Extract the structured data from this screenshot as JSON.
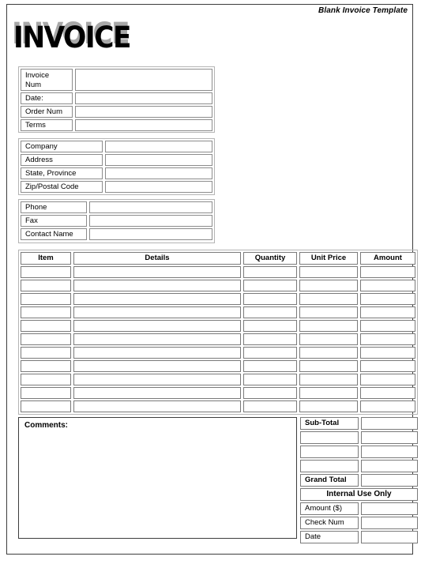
{
  "header": {
    "title": "Blank Invoice Template"
  },
  "wordmark": {
    "text": "INVOICE",
    "shadow_color": "#a8a8a8",
    "text_color": "#000000"
  },
  "invoice_fields": [
    {
      "label": "Invoice\nNum",
      "value": "",
      "two_line": true
    },
    {
      "label": "Date:",
      "value": "",
      "two_line": false
    },
    {
      "label": "Order Num",
      "value": "",
      "two_line": false
    },
    {
      "label": "Terms",
      "value": "",
      "two_line": false
    }
  ],
  "company_fields": [
    {
      "label": "Company",
      "value": ""
    },
    {
      "label": "Address",
      "value": ""
    },
    {
      "label": "State, Province",
      "value": ""
    },
    {
      "label": "Zip/Postal Code",
      "value": ""
    }
  ],
  "contact_fields": [
    {
      "label": "Phone",
      "value": ""
    },
    {
      "label": "Fax",
      "value": ""
    },
    {
      "label": "Contact Name",
      "value": ""
    }
  ],
  "items_table": {
    "columns": [
      "Item",
      "Details",
      "Quantity",
      "Unit Price",
      "Amount"
    ],
    "rows": [
      {
        "item": "",
        "details": "",
        "quantity": "",
        "unit_price": "",
        "amount": ""
      },
      {
        "item": "",
        "details": "",
        "quantity": "",
        "unit_price": "",
        "amount": ""
      },
      {
        "item": "",
        "details": "",
        "quantity": "",
        "unit_price": "",
        "amount": ""
      },
      {
        "item": "",
        "details": "",
        "quantity": "",
        "unit_price": "",
        "amount": ""
      },
      {
        "item": "",
        "details": "",
        "quantity": "",
        "unit_price": "",
        "amount": ""
      },
      {
        "item": "",
        "details": "",
        "quantity": "",
        "unit_price": "",
        "amount": ""
      },
      {
        "item": "",
        "details": "",
        "quantity": "",
        "unit_price": "",
        "amount": ""
      },
      {
        "item": "",
        "details": "",
        "quantity": "",
        "unit_price": "",
        "amount": ""
      },
      {
        "item": "",
        "details": "",
        "quantity": "",
        "unit_price": "",
        "amount": ""
      },
      {
        "item": "",
        "details": "",
        "quantity": "",
        "unit_price": "",
        "amount": ""
      },
      {
        "item": "",
        "details": "",
        "quantity": "",
        "unit_price": "",
        "amount": ""
      }
    ]
  },
  "comments": {
    "label": "Comments:",
    "value": ""
  },
  "totals": {
    "sub_total_label": "Sub-Total",
    "sub_total_value": "",
    "blank_rows": [
      {
        "label": "",
        "value": ""
      },
      {
        "label": "",
        "value": ""
      },
      {
        "label": "",
        "value": ""
      }
    ],
    "grand_total_label": "Grand Total",
    "grand_total_value": "",
    "internal_banner": "Internal Use Only",
    "internal_rows": [
      {
        "label": "Amount ($)",
        "value": ""
      },
      {
        "label": "Check Num",
        "value": ""
      },
      {
        "label": "Date",
        "value": ""
      }
    ]
  }
}
